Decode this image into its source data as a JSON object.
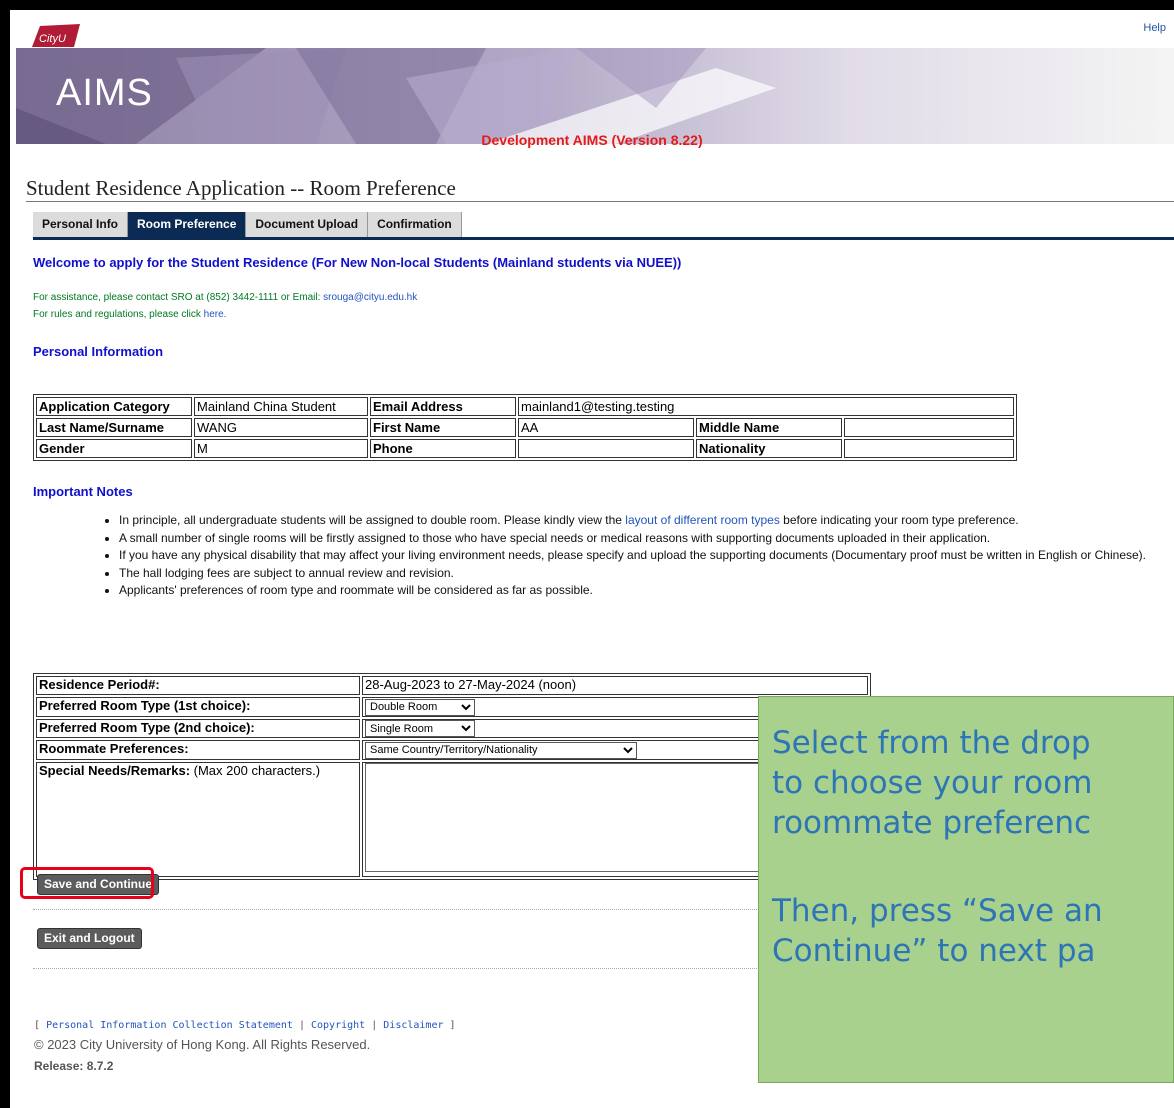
{
  "header": {
    "logo_text": "CityU",
    "app_name": "AIMS",
    "help_label": "Help",
    "dev_banner": "Development AIMS (Version 8.22)"
  },
  "page_title": "Student Residence Application -- Room Preference",
  "tabs": [
    {
      "label": "Personal Info",
      "active": false
    },
    {
      "label": "Room Preference",
      "active": true
    },
    {
      "label": "Document Upload",
      "active": false
    },
    {
      "label": "Confirmation",
      "active": false
    }
  ],
  "welcome": "Welcome to apply for the Student Residence (For New Non-local Students (Mainland students via NUEE))",
  "assistance": {
    "prefix": "For assistance, please contact SRO at (852) 3442-1111 or Email: ",
    "email": "srouga@cityu.edu.hk",
    "rules_prefix": "For rules and regulations, please click ",
    "rules_link": "here",
    "rules_suffix": "."
  },
  "personal_info": {
    "section_title": "Personal Information",
    "application_category_label": "Application Category",
    "application_category": "Mainland China Student",
    "email_label": "Email Address",
    "email": "mainland1@testing.testing",
    "last_name_label": "Last Name/Surname",
    "last_name": "WANG",
    "first_name_label": "First Name",
    "first_name": "AA",
    "middle_name_label": "Middle Name",
    "middle_name": "",
    "gender_label": "Gender",
    "gender": "M",
    "phone_label": "Phone",
    "phone": "",
    "nationality_label": "Nationality",
    "nationality": ""
  },
  "notes": {
    "title": "Important Notes",
    "item1_prefix": "In principle, all undergraduate students will be assigned to double room. Please kindly view the ",
    "item1_link": "layout of different room types",
    "item1_suffix": " before indicating your room type preference.",
    "item2": "A small number of single rooms will be firstly assigned to those who have special needs or medical reasons with supporting documents uploaded in their application.",
    "item3": "If you have any physical disability that may affect your living environment needs, please specify and upload the supporting documents (Documentary proof must be written in English or Chinese).",
    "item4": "The hall lodging fees are subject to annual review and revision.",
    "item5": "Applicants' preferences of room type and roommate will be considered as far as possible."
  },
  "preferences": {
    "period_label": "Residence Period#:",
    "period_value": "28-Aug-2023 to 27-May-2024 (noon)",
    "room1_label": "Preferred Room Type (1st choice):",
    "room1_value": "Double Room",
    "room2_label": "Preferred Room Type (2nd choice):",
    "room2_value": "Single Room",
    "roommate_label": "Roommate Preferences:",
    "roommate_value": "Same Country/Territory/Nationality",
    "remarks_label": "Special Needs/Remarks:",
    "remarks_hint": " (Max 200 characters.)",
    "remarks_value": ""
  },
  "buttons": {
    "save": "Save and Continue",
    "exit": "Exit and Logout"
  },
  "footer": {
    "open_bracket": "[",
    "link1": "Personal Information Collection Statement",
    "sep": "|",
    "link2": "Copyright",
    "link3": "Disclaimer",
    "close_bracket": "]",
    "copyright": "© 2023 City University of Hong Kong. All Rights Reserved.",
    "release": "Release: 8.7.2"
  },
  "tip": {
    "line1": "Select from the drop",
    "line2": "to choose your room",
    "line3": "roommate preferenc",
    "line4": "Then, press “Save an",
    "line5": "Continue” to next pa"
  },
  "colors": {
    "tab_active": "#0b2b55",
    "dev_banner": "#e31b1b",
    "section_title": "#1010cc",
    "assistance_text": "#007a22",
    "highlight": "#e8001a",
    "tip_background": "#a9d18e",
    "tip_text": "#2e75b6"
  }
}
